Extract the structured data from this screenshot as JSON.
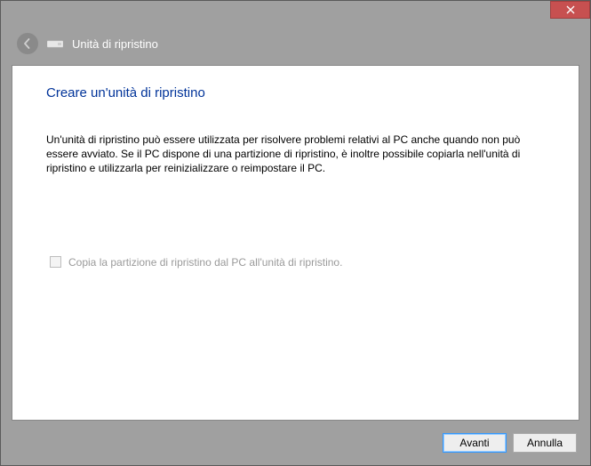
{
  "window": {
    "header_title": "Unità di ripristino"
  },
  "wizard": {
    "title": "Creare un'unità di ripristino",
    "body": "Un'unità di ripristino può essere utilizzata per risolvere problemi relativi al PC anche quando non può essere avviato. Se il PC dispone di una partizione di ripristino, è inoltre possibile copiarla nell'unità di ripristino e utilizzarla per reinizializzare o reimpostare il PC.",
    "checkbox_label": "Copia la partizione di ripristino dal PC all'unità di ripristino."
  },
  "buttons": {
    "next": "Avanti",
    "cancel": "Annulla"
  }
}
